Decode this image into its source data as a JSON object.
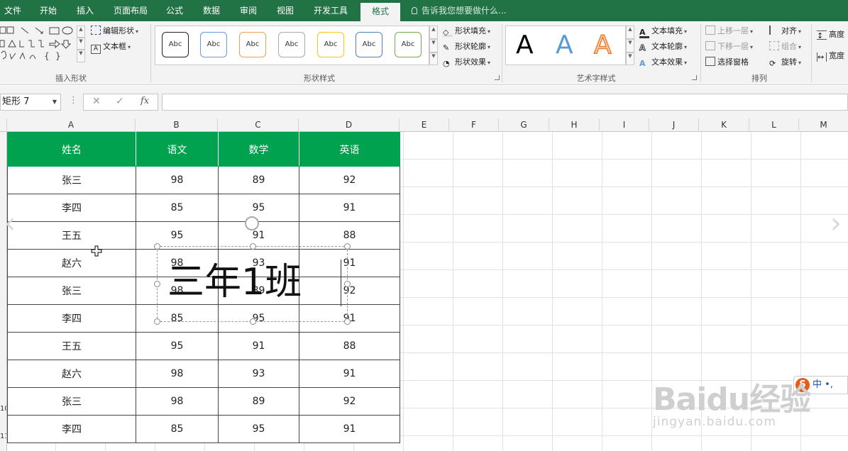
{
  "menu": {
    "tabs": [
      "文件",
      "开始",
      "插入",
      "页面布局",
      "公式",
      "数据",
      "审阅",
      "视图",
      "开发工具",
      "格式"
    ],
    "active_tab": "格式",
    "tell_me": "告诉我您想要做什么..."
  },
  "ribbon": {
    "insert_shapes": {
      "edit_shape": "编辑形状",
      "text_box": "文本框",
      "label": "插入形状"
    },
    "shape_styles": {
      "style_text": "Abc",
      "fill": "形状填充",
      "outline": "形状轮廓",
      "effects": "形状效果",
      "label": "形状样式"
    },
    "wordart": {
      "sample": "A",
      "text_fill": "文本填充",
      "text_outline": "文本轮廓",
      "text_effects": "文本效果",
      "label": "艺术字样式"
    },
    "arrange": {
      "bring_forward": "上移一层",
      "send_backward": "下移一层",
      "selection_pane": "选择窗格",
      "align": "对齐",
      "group": "组合",
      "rotate": "旋转",
      "label": "排列"
    },
    "size": {
      "height": "高度",
      "width": "宽度"
    }
  },
  "formula_bar": {
    "name_box": "矩形 7",
    "fx": "fx",
    "cancel": "✕",
    "enter": "✓"
  },
  "columns": [
    "A",
    "B",
    "C",
    "D",
    "E",
    "F",
    "G",
    "H",
    "I",
    "J",
    "K",
    "L",
    "M"
  ],
  "row_labels": [
    "10",
    "11"
  ],
  "table": {
    "headers": [
      "姓名",
      "语文",
      "数学",
      "英语"
    ],
    "rows": [
      [
        "张三",
        "98",
        "89",
        "92"
      ],
      [
        "李四",
        "85",
        "95",
        "91"
      ],
      [
        "王五",
        "95",
        "91",
        "88"
      ],
      [
        "赵六",
        "98",
        "93",
        "91"
      ],
      [
        "张三",
        "98",
        "89",
        "92"
      ],
      [
        "李四",
        "85",
        "95",
        "91"
      ],
      [
        "王五",
        "95",
        "91",
        "88"
      ],
      [
        "赵六",
        "98",
        "93",
        "91"
      ],
      [
        "张三",
        "98",
        "89",
        "92"
      ],
      [
        "李四",
        "85",
        "95",
        "91"
      ]
    ]
  },
  "textbox": {
    "text": "三年1班"
  },
  "ime": {
    "label": "中 •,",
    "logo": "S"
  },
  "watermark": {
    "brand": "Baidu经验",
    "url": "jingyan.baidu.com"
  },
  "colors": {
    "menu_green": "#217346",
    "header_green": "#00a250"
  }
}
